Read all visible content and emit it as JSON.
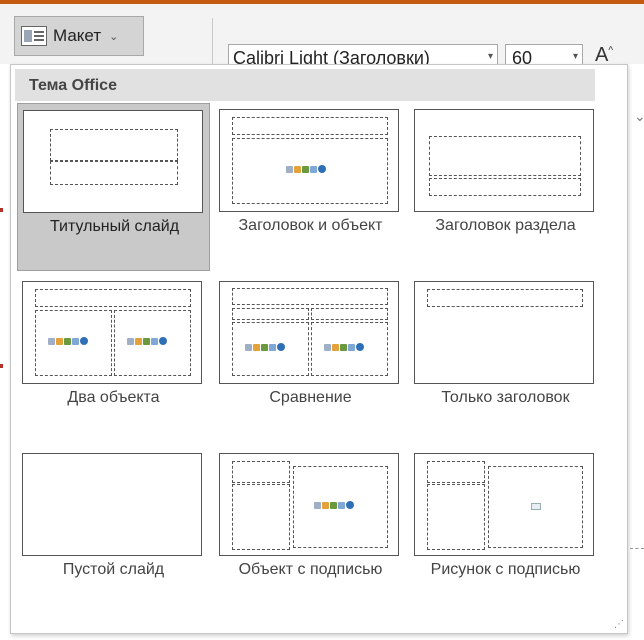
{
  "ribbon": {
    "layout_button_label": "Макет",
    "font_name": "Calibri Light (Заголовки)",
    "font_size": "60",
    "grow_font_glyph": "A"
  },
  "gallery": {
    "header": "Тема Office",
    "layouts": [
      {
        "label": "Титульный слайд",
        "selected": true
      },
      {
        "label": "Заголовок и объект"
      },
      {
        "label": "Заголовок раздела"
      },
      {
        "label": "Два объекта"
      },
      {
        "label": "Сравнение"
      },
      {
        "label": "Только заголовок"
      },
      {
        "label": "Пустой слайд"
      },
      {
        "label": "Объект с подписью"
      },
      {
        "label": "Рисунок с подписью"
      }
    ]
  },
  "icons": {
    "layout": "slide-layout-icon",
    "dropdown": "chevron-down-icon",
    "grow_font": "grow-font-icon",
    "content_placeholder": "content-placeholder-icons",
    "picture_placeholder": "picture-icon",
    "resize": "resize-grip-icon"
  },
  "colors": {
    "accent": "#c55a11",
    "selected_tile": "#c9c9c9",
    "header_bg": "#e1e1e1"
  }
}
